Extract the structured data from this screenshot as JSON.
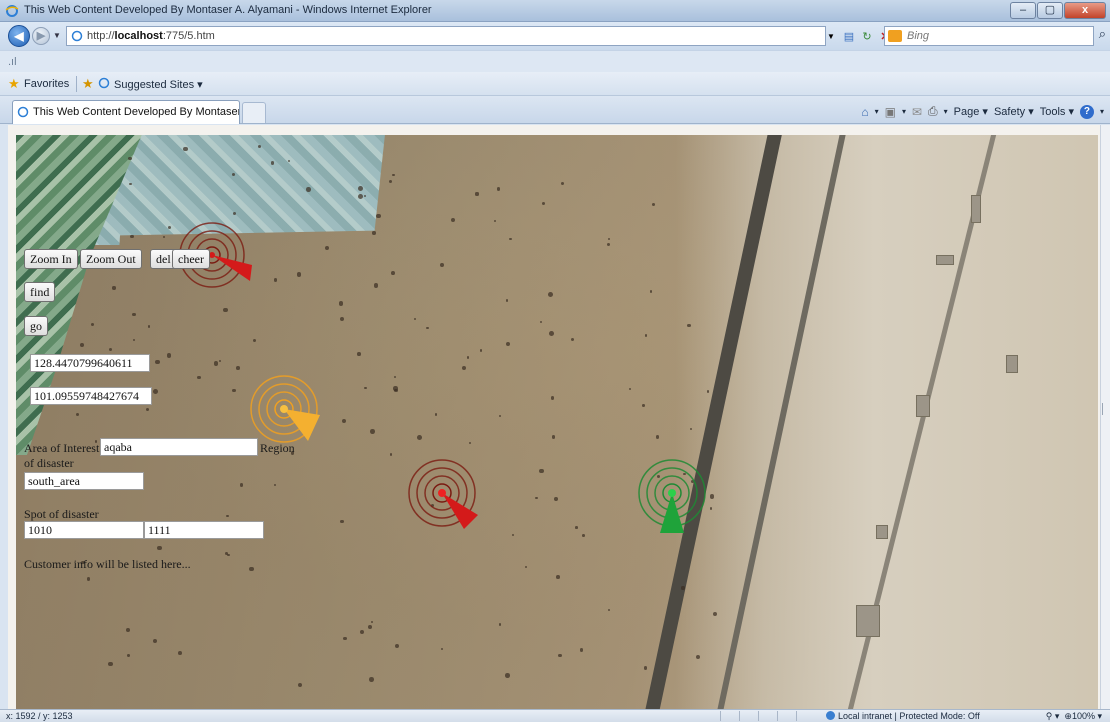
{
  "window": {
    "title": "This Web Content Developed By Montaser A. Alyamani - Windows Internet Explorer",
    "minimize": "–",
    "maximize": "▢",
    "close": "x"
  },
  "address_bar": {
    "url_prefix": "http://",
    "url_host": "localhost",
    "url_rest": ":775/5.htm",
    "search_placeholder": "Bing"
  },
  "favorites_bar": {
    "favorites_label": "Favorites",
    "suggested_sites_label": "Suggested Sites ▾"
  },
  "tab": {
    "label": "This Web Content Developed By Montaser A. Aly..."
  },
  "command_bar": {
    "page_label": "Page ▾",
    "safety_label": "Safety ▾",
    "tools_label": "Tools ▾"
  },
  "map_controls": {
    "zoom_in": "Zoom In",
    "zoom_out": "Zoom Out",
    "del": "del",
    "cheer": "cheer",
    "find": "find",
    "go": "go",
    "x_value": "128.4470799640611",
    "y_value": "101.09559748427674",
    "area_of_interest_label": "Area of Interest",
    "area_of_interest_value": "aqaba",
    "region_label": "Region",
    "of_disaster_label": "of disaster",
    "region_value": "south_area",
    "spot_label": "Spot of disaster",
    "spot_x": "1010",
    "spot_y": "1111",
    "customer_info": "Customer info will be listed here..."
  },
  "markers": [
    {
      "name": "red",
      "color": "#d41a1a"
    },
    {
      "name": "orange",
      "color": "#f0a020"
    },
    {
      "name": "red",
      "color": "#d41a1a"
    },
    {
      "name": "green",
      "color": "#1fa33a"
    }
  ],
  "status_bar": {
    "coords": "x: 1592 / y: 1253",
    "zone": "Local intranet | Protected Mode: Off",
    "zoom": "100%"
  }
}
